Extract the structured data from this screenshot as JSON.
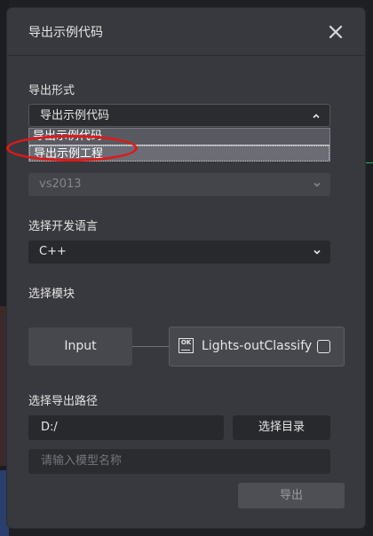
{
  "dialog": {
    "title": "导出示例代码"
  },
  "export_format": {
    "label": "导出形式",
    "selected": "导出示例代码",
    "options": [
      "导出示例代码",
      "导出示例工程"
    ],
    "highlighted_option": "导出示例工程"
  },
  "ide": {
    "selected": "vs2013"
  },
  "language": {
    "label": "选择开发语言",
    "selected": "C++"
  },
  "modules": {
    "label": "选择模块",
    "input_node": "Input",
    "lights_node": "Lights-outClassify",
    "lights_checked": false
  },
  "export_path": {
    "label": "选择导出路径",
    "value": "D:/",
    "choose_dir_button": "选择目录",
    "model_name_placeholder": "请输入模型名称",
    "model_name_value": ""
  },
  "actions": {
    "export_button": "导出"
  },
  "colors": {
    "dialog_bg": "#38393e",
    "annotation_red": "#e01818"
  }
}
